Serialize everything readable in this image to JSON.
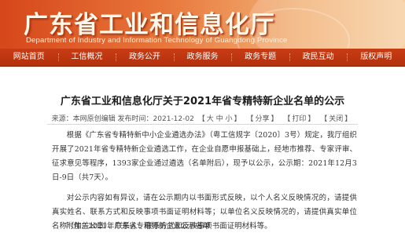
{
  "header": {
    "site_title": "广东省工业和信息化厅",
    "site_subtitle_en": "Department of Industry and Information Technology of Guangdong Province"
  },
  "nav": {
    "items": [
      "网站首页",
      "工信概况",
      "政务公开",
      "政务服务",
      "政务专题",
      "政民互动",
      "版权声明"
    ]
  },
  "article": {
    "title": "广东省工业和信息化厅关于2021年省专精特新企业名单的公示",
    "meta": {
      "source": "来源：本网原创编辑 发布时间：2021-12-02",
      "font_large": "大",
      "font_medium": "中",
      "font_small": "小",
      "share": "分享",
      "print": "打印",
      "close": "关闭"
    },
    "paragraphs": [
      "根据《广东省专精特新中小企业遴选办法》（粤工信规字〔2020〕3号）规定，我厅组织开展了2021年省专精特新企业遴选工作，在企业自愿申报基础上，经地市推荐、专家评审、征求意见等程序，1393家企业通过遴选（名单附后），现予以公示，公示期：2021年12月3日-9日（共7天）。",
      "对公示内容如有异议，请在公示期内以书面形式反映，以个人名义反映情况的，请提供真实姓名、联系方式和反映事项书面证明材料等；以单位名义反映情况的，请提供真实单位名称（加盖公章）、联系人、联系方式和反映事项书面证明材料等。"
    ],
    "attachment": "附件：2021年广东省专精特新企业公示名单"
  }
}
